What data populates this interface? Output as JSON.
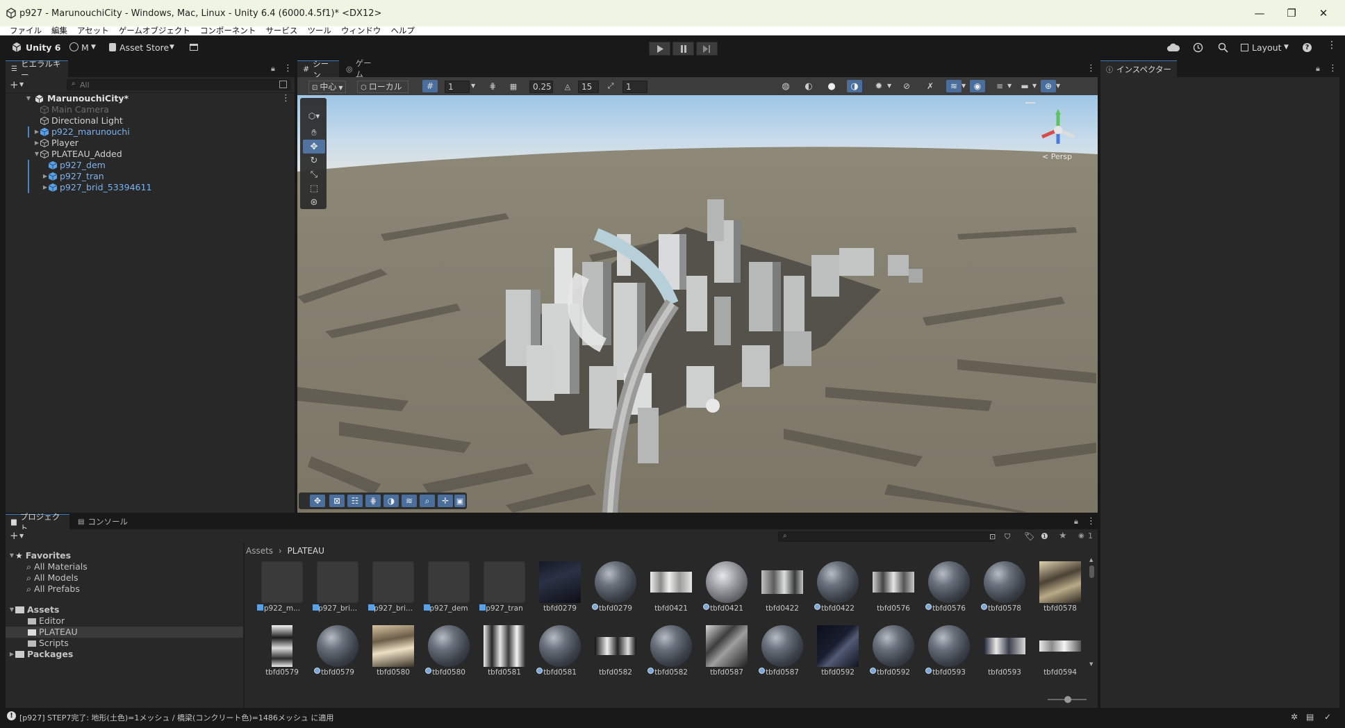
{
  "window": {
    "title": "p927 - MarunouchiCity - Windows, Mac, Linux - Unity 6.4 (6000.4.5f1)* <DX12>",
    "minimize": "—",
    "maximize": "❐",
    "close": "✕"
  },
  "menu": [
    "ファイル",
    "編集",
    "アセット",
    "ゲームオブジェクト",
    "コンポーネント",
    "サービス",
    "ツール",
    "ウィンドウ",
    "ヘルプ"
  ],
  "toolbar": {
    "unity": "Unity 6",
    "account": "M",
    "asset_store": "Asset Store",
    "layout": "Layout"
  },
  "hierarchy": {
    "tab": "ヒエラルキー",
    "search_placeholder": "All",
    "scene": "MarunouchiCity*",
    "items": [
      {
        "label": "Main Camera",
        "depth": 1,
        "disabled": true,
        "prefab": false,
        "expand": ""
      },
      {
        "label": "Directional Light",
        "depth": 1,
        "disabled": false,
        "prefab": false,
        "expand": ""
      },
      {
        "label": "p922_marunouchi",
        "depth": 1,
        "disabled": false,
        "prefab": true,
        "expand": "▶"
      },
      {
        "label": "Player",
        "depth": 1,
        "disabled": false,
        "prefab": false,
        "expand": "▶"
      },
      {
        "label": "PLATEAU_Added",
        "depth": 1,
        "disabled": false,
        "prefab": false,
        "expand": "▼"
      },
      {
        "label": "p927_dem",
        "depth": 2,
        "disabled": false,
        "prefab": true,
        "expand": ""
      },
      {
        "label": "p927_tran",
        "depth": 2,
        "disabled": false,
        "prefab": true,
        "expand": "▶"
      },
      {
        "label": "p927_brid_53394611",
        "depth": 2,
        "disabled": false,
        "prefab": true,
        "expand": "▶"
      }
    ]
  },
  "scene": {
    "tab_scene": "シーン",
    "tab_game": "ゲーム",
    "pivot": "中心",
    "space": "ローカル",
    "grid_size": "1",
    "snap_rot": "0.25",
    "snap_angle": "15",
    "snap_scale": "1",
    "persp": "< Persp"
  },
  "inspector": {
    "tab": "インスペクター"
  },
  "project": {
    "tab_project": "プロジェクト",
    "tab_console": "コンソール",
    "breadcrumb_root": "Assets",
    "breadcrumb_leaf": "PLATEAU",
    "hidden_count": "1",
    "favorites_label": "Favorites",
    "favorites": [
      "All Materials",
      "All Models",
      "All Prefabs"
    ],
    "assets_label": "Assets",
    "folders": [
      "Editor",
      "PLATEAU",
      "Scripts"
    ],
    "packages_label": "Packages",
    "row1": [
      {
        "label": "p922_m...",
        "kind": "model"
      },
      {
        "label": "p927_bri...",
        "kind": "model2"
      },
      {
        "label": "p927_bri...",
        "kind": "model3"
      },
      {
        "label": "p927_dem",
        "kind": "model4"
      },
      {
        "label": "p927_tran",
        "kind": "model5"
      },
      {
        "label": "tbfd0279",
        "kind": "tex_dark"
      },
      {
        "label": "tbfd0279",
        "kind": "mat"
      },
      {
        "label": "tbfd0421",
        "kind": "tex_light"
      },
      {
        "label": "tbfd0421",
        "kind": "mat2"
      },
      {
        "label": "tbfd0422",
        "kind": "tex_mix"
      },
      {
        "label": "tbfd0422",
        "kind": "mat3"
      },
      {
        "label": "tbfd0576",
        "kind": "tex_mix2"
      },
      {
        "label": "tbfd0576",
        "kind": "mat4"
      },
      {
        "label": "tbfd0578",
        "kind": "mat"
      },
      {
        "label": "tbfd0578",
        "kind": "tex_brown"
      }
    ],
    "row2": [
      {
        "label": "tbfd0579",
        "kind": "tex_tall"
      },
      {
        "label": "tbfd0579",
        "kind": "mat"
      },
      {
        "label": "tbfd0580",
        "kind": "tex_brown2"
      },
      {
        "label": "tbfd0580",
        "kind": "mat3"
      },
      {
        "label": "tbfd0581",
        "kind": "tex_city"
      },
      {
        "label": "tbfd0581",
        "kind": "mat3"
      },
      {
        "label": "tbfd0582",
        "kind": "tex_strip"
      },
      {
        "label": "tbfd0582",
        "kind": "mat"
      },
      {
        "label": "tbfd0587",
        "kind": "tex_city2"
      },
      {
        "label": "tbfd0587",
        "kind": "mat3"
      },
      {
        "label": "tbfd0592",
        "kind": "tex_dark2"
      },
      {
        "label": "tbfd0592",
        "kind": "mat"
      },
      {
        "label": "tbfd0593",
        "kind": "mat"
      },
      {
        "label": "tbfd0593",
        "kind": "tex_strip2"
      },
      {
        "label": "tbfd0594",
        "kind": "tex_strip3"
      }
    ]
  },
  "status": {
    "message": "[p927] STEP7完了: 地形(土色)=1メッシュ / 橋梁(コンクリート色)=1486メッシュ に適用"
  }
}
